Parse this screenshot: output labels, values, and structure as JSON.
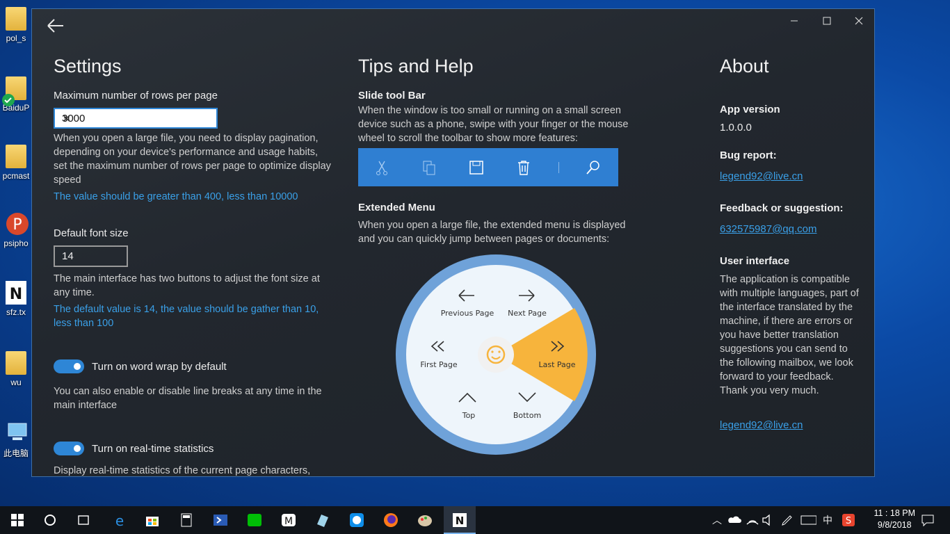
{
  "desktop": {
    "icons": [
      {
        "label": "pol_s",
        "icon": "folder-icon"
      },
      {
        "label": "BaiduP",
        "icon": "folder-icon"
      },
      {
        "label": "pcmast",
        "icon": "folder-icon"
      },
      {
        "label": "psipho",
        "icon": "psiphon-app-icon"
      },
      {
        "label": "sfz.tx",
        "icon": "notepad-app-icon"
      },
      {
        "label": "wu",
        "icon": "user-folder-icon"
      },
      {
        "label": "此电脑",
        "icon": "computer-icon"
      }
    ]
  },
  "window": {
    "controls": {
      "minimize": "—",
      "maximize": "☐",
      "close": "✕"
    },
    "settings": {
      "title": "Settings",
      "rows_label": "Maximum number of rows per page",
      "rows_value": "3000",
      "rows_desc": "When you open a large file, you need to display pagination, depending on your device's performance and usage habits, set the maximum number of rows per page to optimize display speed",
      "rows_hint": "The value should be greater than 400, less than 10000",
      "font_label": "Default font size",
      "font_value": "14",
      "font_desc": "The main interface has two buttons to adjust the font size at any time.",
      "font_hint": "The default value is 14, the value should be gather than 10, less than 100",
      "wrap_label": "Turn on word wrap by default",
      "wrap_desc": "You can also enable or disable line breaks at any time in the main interface",
      "stats_label": "Turn on real-time statistics",
      "stats_desc": "Display real-time statistics of the current page characters,"
    },
    "tips": {
      "title": "Tips and Help",
      "slide_title": "Slide tool Bar",
      "slide_desc": "When the window is too small or running on a small screen device such as a phone, swipe with your finger or the mouse wheel to scroll the toolbar to show more features:",
      "ext_title": "Extended Menu",
      "ext_desc": "When you open a large file, the extended menu is displayed and you can quickly jump between pages or documents:",
      "menu": {
        "previous": "Previous Page",
        "next": "Next Page",
        "first": "First Page",
        "last": "Last Page",
        "top": "Top",
        "bottom": "Bottom"
      }
    },
    "about": {
      "title": "About",
      "version_label": "App version",
      "version": "1.0.0.0",
      "bug_label": "Bug report:",
      "bug_email": "legend92@live.cn",
      "feedback_label": "Feedback or suggestion:",
      "feedback_email": "632575987@qq.com",
      "ui_label": "User interface",
      "ui_desc": "The application is compatible with multiple languages, part of the interface translated by the machine, if there are errors or you have better translation suggestions you can send to the following mailbox, we look forward to your feedback. Thank you very much.",
      "ui_email": "legend92@live.cn"
    }
  },
  "taskbar": {
    "clock_time": "11 : 18 PM",
    "clock_date": "9/8/2018",
    "ime": "中",
    "accent": "#2e86d6"
  }
}
